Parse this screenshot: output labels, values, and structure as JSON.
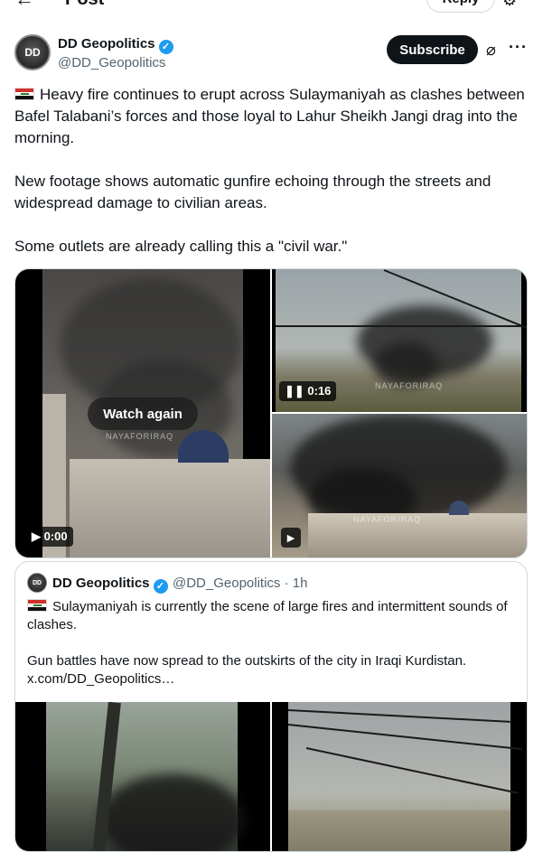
{
  "header": {
    "title": "Post",
    "back_icon": "←",
    "reply_label": "Reply"
  },
  "author": {
    "name": "DD Geopolitics",
    "handle": "@DD_Geopolitics",
    "avatar_text": "DD",
    "verified_icon": "✓"
  },
  "actions": {
    "subscribe_label": "Subscribe",
    "grok_icon": "⌀",
    "more_icon": "···"
  },
  "post": {
    "paragraphs": [
      "Heavy fire continues to erupt across Sulaymaniyah as clashes between Bafel Talabani’s forces and those loyal to Lahur Sheikh Jangi drag into the morning.",
      "New footage shows automatic gunfire echoing through the streets and widespread damage to civilian areas.",
      "Some outlets are already calling this a \"civil war.\""
    ]
  },
  "media": {
    "left": {
      "overlay_label": "Watch again",
      "time": "▶ 0:00",
      "watermark": "NAYAFORIRAQ"
    },
    "top_right": {
      "time": "❚❚ 0:16",
      "watermark": "NAYAFORIRAQ"
    },
    "bottom_right": {
      "play_icon": "▶",
      "watermark": "NAYAFORIRAQ"
    }
  },
  "quote": {
    "name": "DD Geopolitics",
    "handle_time": "@DD_Geopolitics · 1h",
    "avatar_text": "DD",
    "paragraphs": [
      "Sulaymaniyah is currently the scene of large fires and intermittent sounds of clashes.",
      "Gun battles have now spread to the outskirts of the city in Iraqi Kurdistan. x.com/DD_Geopolitics…"
    ]
  },
  "colors": {
    "accent": "#1d9bf0",
    "text": "#0f1419",
    "muted": "#536471",
    "border": "#cfd9de"
  }
}
